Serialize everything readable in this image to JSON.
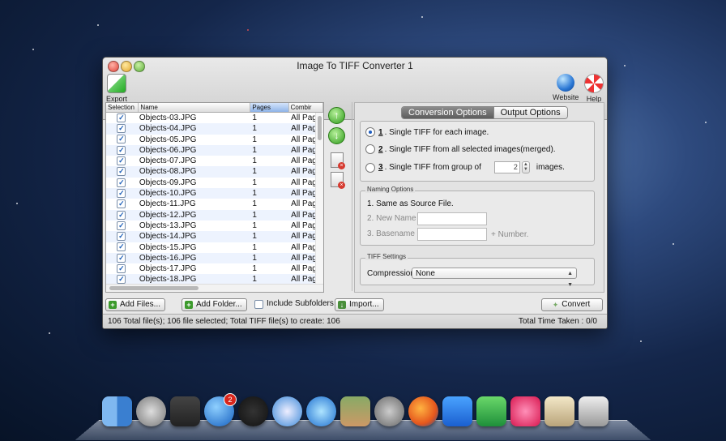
{
  "window": {
    "title": "Image To TIFF Converter 1"
  },
  "toolbar": {
    "export_label": "Export",
    "website_label": "Website",
    "help_label": "Help"
  },
  "file_list": {
    "columns": [
      "Selection",
      "Name",
      "Pages",
      "Combir"
    ],
    "rows": [
      {
        "name": "Objects-03.JPG",
        "pages": "1",
        "combine": "All Pag",
        "checked": true
      },
      {
        "name": "Objects-04.JPG",
        "pages": "1",
        "combine": "All Pag",
        "checked": true
      },
      {
        "name": "Objects-05.JPG",
        "pages": "1",
        "combine": "All Pag",
        "checked": true
      },
      {
        "name": "Objects-06.JPG",
        "pages": "1",
        "combine": "All Pag",
        "checked": true
      },
      {
        "name": "Objects-07.JPG",
        "pages": "1",
        "combine": "All Pag",
        "checked": true
      },
      {
        "name": "Objects-08.JPG",
        "pages": "1",
        "combine": "All Pag",
        "checked": true
      },
      {
        "name": "Objects-09.JPG",
        "pages": "1",
        "combine": "All Pag",
        "checked": true
      },
      {
        "name": "Objects-10.JPG",
        "pages": "1",
        "combine": "All Pag",
        "checked": true
      },
      {
        "name": "Objects-11.JPG",
        "pages": "1",
        "combine": "All Pag",
        "checked": true
      },
      {
        "name": "Objects-12.JPG",
        "pages": "1",
        "combine": "All Pag",
        "checked": true
      },
      {
        "name": "Objects-13.JPG",
        "pages": "1",
        "combine": "All Pag",
        "checked": true
      },
      {
        "name": "Objects-14.JPG",
        "pages": "1",
        "combine": "All Pag",
        "checked": true
      },
      {
        "name": "Objects-15.JPG",
        "pages": "1",
        "combine": "All Pag",
        "checked": true
      },
      {
        "name": "Objects-16.JPG",
        "pages": "1",
        "combine": "All Pag",
        "checked": true
      },
      {
        "name": "Objects-17.JPG",
        "pages": "1",
        "combine": "All Pag",
        "checked": true
      },
      {
        "name": "Objects-18.JPG",
        "pages": "1",
        "combine": "All Pag",
        "checked": true
      }
    ]
  },
  "tabs": [
    "Conversion Options",
    "Output Options"
  ],
  "conversion": {
    "options": [
      {
        "num": "1",
        "text": ". Single TIFF for each image.",
        "selected": true
      },
      {
        "num": "2",
        "text": ". Single TIFF from all selected images(merged).",
        "selected": false
      },
      {
        "num": "3",
        "text": ". Single TIFF from group of",
        "selected": false
      }
    ],
    "group_count": "2",
    "group_suffix": "images."
  },
  "naming": {
    "title": "Naming Options",
    "same_as_source": "1. Same as Source File.",
    "new_name": "2. New Name",
    "basename": "3. Basename",
    "plus_number": "+ Number."
  },
  "tiff": {
    "title": "TIFF Settings",
    "compression_label": "Compression",
    "compression_value": "None"
  },
  "bottom": {
    "add_files": "Add Files...",
    "add_folder": "Add Folder...",
    "include_subfolders": "Include Subfolders",
    "import": "Import...",
    "convert": "Convert"
  },
  "status": {
    "summary": "106 Total file(s); 106 file selected; Total TIFF file(s) to create: 106",
    "time_taken": "Total Time Taken :  0/0"
  },
  "dock": {
    "app_store_badge": "2",
    "icons": [
      "finder-icon",
      "launchpad-icon",
      "mission-control-icon",
      "app-store-icon",
      "dashboard-icon",
      "safari-icon",
      "itunes-icon",
      "iphoto-icon",
      "system-preferences-icon",
      "firefox-icon",
      "word-icon",
      "excel-icon",
      "heart-app-icon",
      "preview-icon",
      "trash-icon"
    ]
  }
}
